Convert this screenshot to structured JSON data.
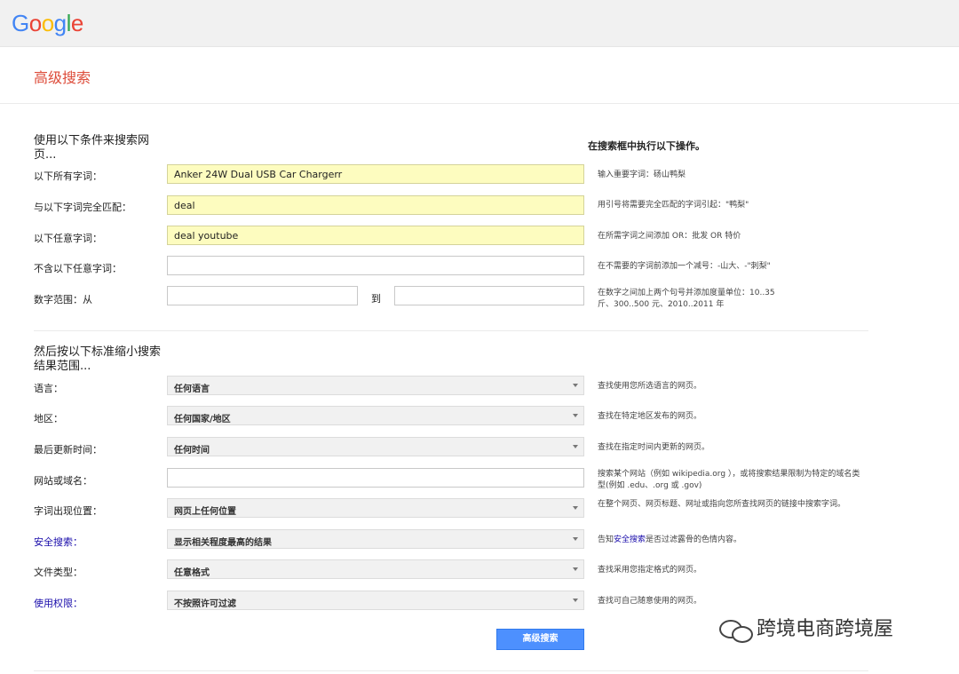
{
  "header": {
    "logo_letters": [
      {
        "ch": "G",
        "color": "#4285F4"
      },
      {
        "ch": "o",
        "color": "#EA4335"
      },
      {
        "ch": "o",
        "color": "#FBBC05"
      },
      {
        "ch": "g",
        "color": "#4285F4"
      },
      {
        "ch": "l",
        "color": "#34A853"
      },
      {
        "ch": "e",
        "color": "#EA4335"
      }
    ]
  },
  "page_title": "高级搜索",
  "section1": {
    "heading": "使用以下条件来搜索网页...",
    "hint_heading": "在搜索框中执行以下操作。",
    "rows": {
      "all_words": {
        "label": "以下所有字词：",
        "value": "Anker 24W Dual USB Car Chargerr",
        "hint": "输入重要字词：砀山鸭梨"
      },
      "exact": {
        "label": "与以下字词完全匹配：",
        "value": "deal",
        "hint": "用引号将需要完全匹配的字词引起：\"鸭梨\""
      },
      "any_words": {
        "label": "以下任意字词：",
        "value": "deal youtube",
        "hint": "在所需字词之间添加 OR：批发 OR 特价"
      },
      "none_words": {
        "label": "不含以下任意字词：",
        "value": "",
        "hint": "在不需要的字词前添加一个减号：-山大、-\"刺梨\""
      },
      "range": {
        "label": "数字范围：从",
        "to": "到",
        "hint": "在数字之间加上两个句号并添加度量单位：10..35 斤、300..500 元、2010..2011 年"
      }
    }
  },
  "section2": {
    "heading": "然后按以下标准缩小搜索结果范围...",
    "rows": {
      "language": {
        "label": "语言：",
        "value": "任何语言",
        "hint": "查找使用您所选语言的网页。"
      },
      "region": {
        "label": "地区：",
        "value": "任何国家/地区",
        "hint": "查找在特定地区发布的网页。"
      },
      "updated": {
        "label": "最后更新时间：",
        "value": "任何时间",
        "hint": "查找在指定时间内更新的网页。"
      },
      "site": {
        "label": "网站或域名：",
        "value": "",
        "hint": "搜索某个网站（例如 wikipedia.org ），或将搜索结果限制为特定的域名类型(例如 .edu、.org 或 .gov)"
      },
      "position": {
        "label": "字词出现位置：",
        "value": "网页上任何位置",
        "hint": "在整个网页、网页标题、网址或指向您所查找网页的链接中搜索字词。"
      },
      "safesearch": {
        "label": "安全搜索：",
        "value": "显示相关程度最高的结果",
        "hint_pre": "告知",
        "hint_link": "安全搜索",
        "hint_post": "是否过滤露骨的色情内容。"
      },
      "filetype": {
        "label": "文件类型：",
        "value": "任意格式",
        "hint": "查找采用您指定格式的网页。"
      },
      "rights": {
        "label": "使用权限：",
        "value": "不按照许可过滤",
        "hint": "查找可自己随意使用的网页。"
      }
    },
    "submit_label": "高级搜索"
  },
  "watermark": "跨境电商跨境屋"
}
